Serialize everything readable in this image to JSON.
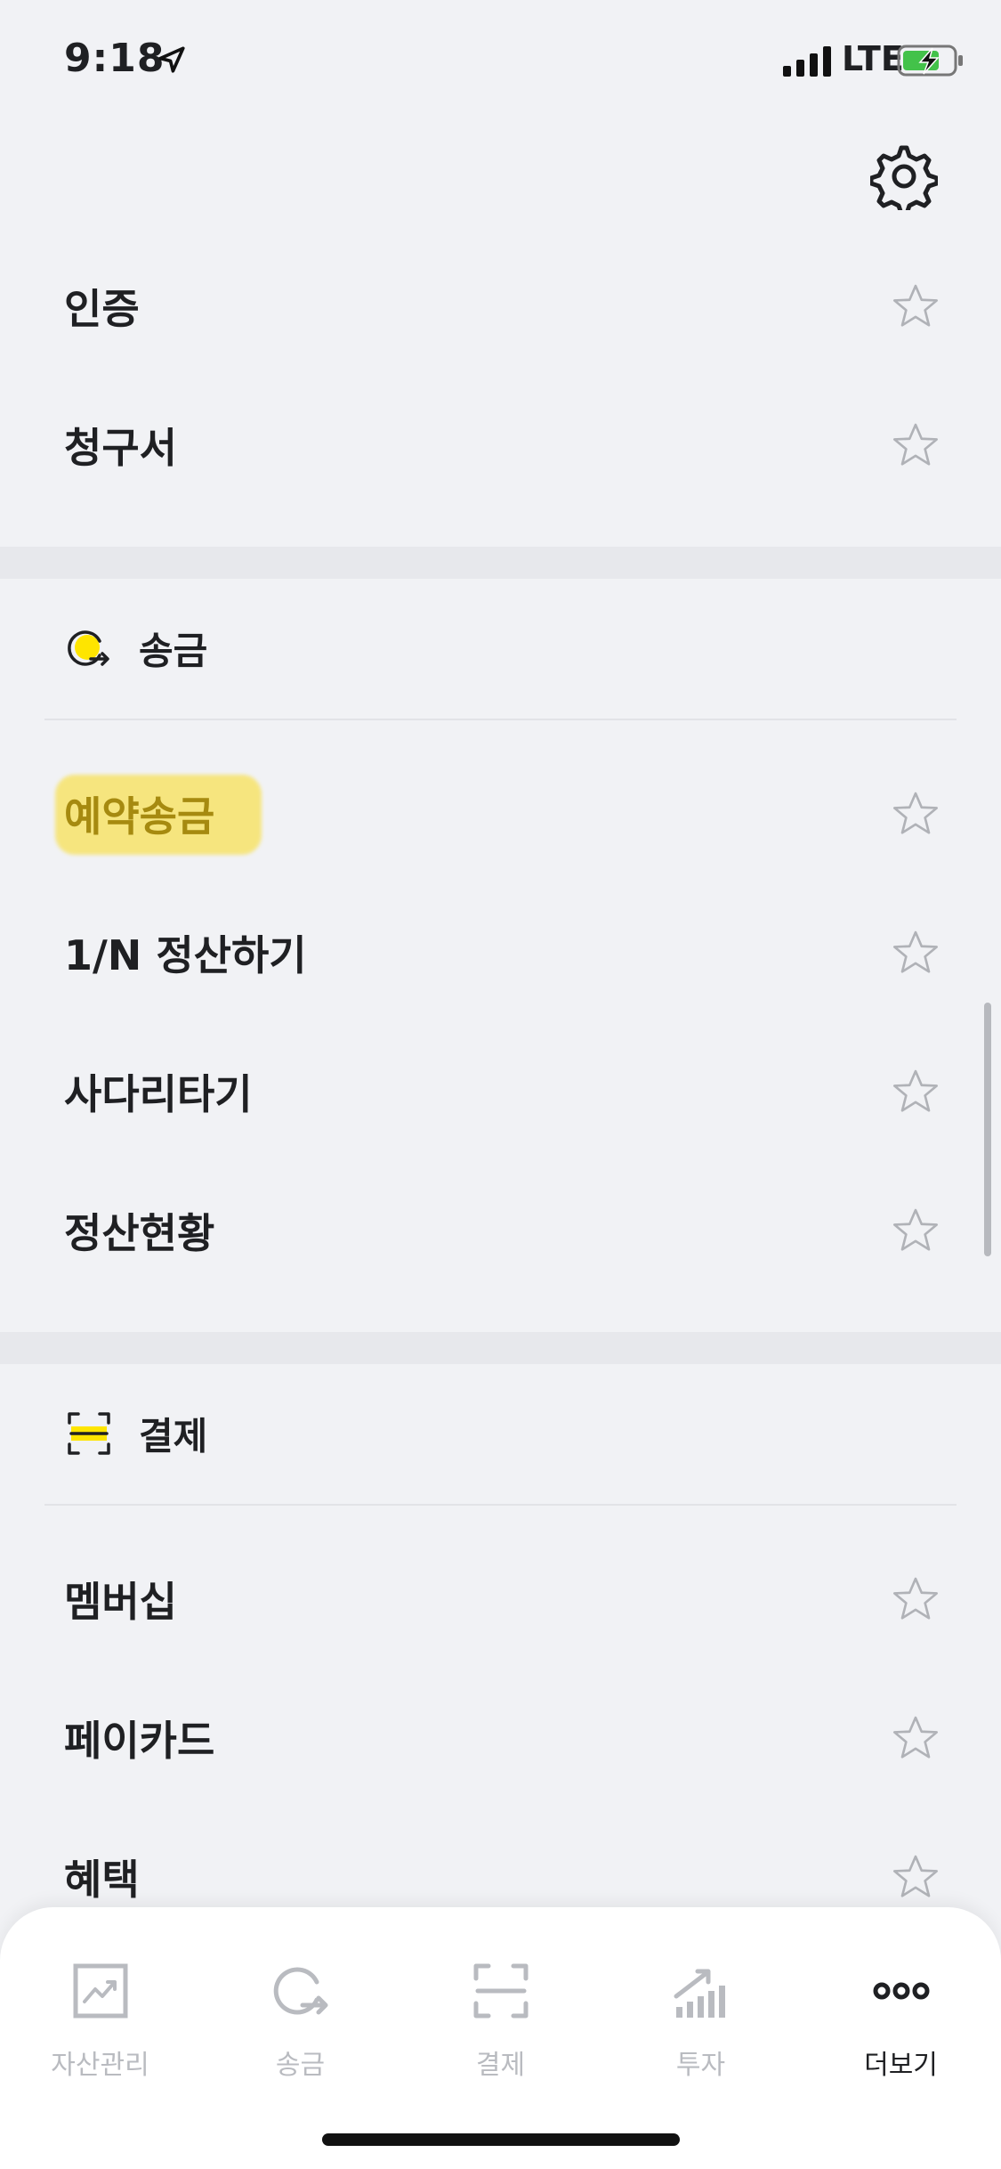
{
  "status_bar": {
    "time": "9:18",
    "network": "LTE"
  },
  "top_items": [
    {
      "label": "인증"
    },
    {
      "label": "청구서"
    }
  ],
  "transfer_section": {
    "title": "송금",
    "items": [
      {
        "label": "예약송금"
      },
      {
        "label": "1/N 정산하기"
      },
      {
        "label": "사다리타기"
      },
      {
        "label": "정산현황"
      }
    ]
  },
  "payment_section": {
    "title": "결제",
    "items": [
      {
        "label": "멤버십"
      },
      {
        "label": "페이카드"
      },
      {
        "label": "혜택"
      }
    ]
  },
  "tab_bar": {
    "tabs": [
      {
        "label": "자산관리",
        "icon": "asset-chart-icon"
      },
      {
        "label": "송금",
        "icon": "transfer-icon"
      },
      {
        "label": "결제",
        "icon": "scan-pay-icon"
      },
      {
        "label": "투자",
        "icon": "invest-bars-icon"
      },
      {
        "label": "더보기",
        "icon": "more-dots-icon"
      }
    ],
    "active": "더보기"
  },
  "colors": {
    "background": "#f1f2f5",
    "section_gap": "#e7e8ec",
    "highlight": "#f7e36a",
    "accent_yellow": "#fee500",
    "text": "#1f2023",
    "inactive_tab": "#b9bbc0"
  }
}
